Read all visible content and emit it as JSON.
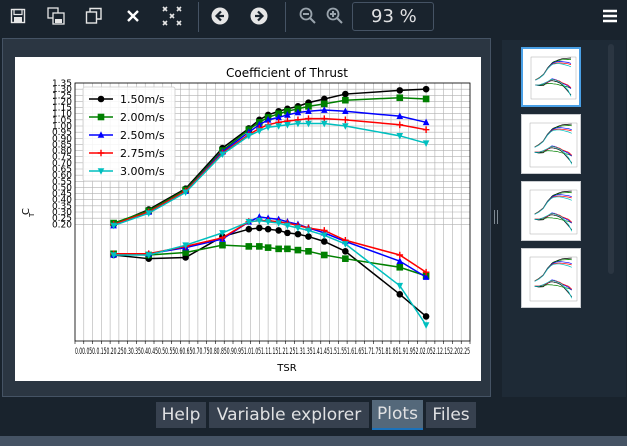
{
  "toolbar": {
    "buttons": [
      "save-icon",
      "save-all-icon",
      "copy-icon",
      "close-icon",
      "close-all-icon",
      "previous-icon",
      "next-icon",
      "zoom-out-icon",
      "zoom-in-icon"
    ],
    "zoom_value": "93 %",
    "menu_icon": "hamburger-menu-icon"
  },
  "tabs": [
    {
      "label": "Help",
      "active": false
    },
    {
      "label": "Variable explorer",
      "active": false
    },
    {
      "label": "Plots",
      "active": true
    },
    {
      "label": "Files",
      "active": false
    }
  ],
  "thumbnails": {
    "count": 4,
    "selected_index": 0
  },
  "colors": {
    "bg": "#19232d",
    "panel": "#2b3642",
    "accent": "#1a72bb"
  },
  "chart_data": {
    "type": "line",
    "title": "Coefficient of Thrust",
    "xlabel": "TSR",
    "ylabel": "C_T",
    "xlim": [
      0,
      2.25
    ],
    "ylim": [
      -0.75,
      1.35
    ],
    "x_ticks": [
      "0.00",
      "0.05",
      "0.10",
      "0.15",
      "0.20",
      "0.25",
      "0.30",
      "0.35",
      "0.40",
      "0.45",
      "0.50",
      "0.55",
      "0.60",
      "0.65",
      "0.70",
      "0.75",
      "0.80",
      "0.85",
      "0.90",
      "0.95",
      "1.00",
      "1.05",
      "1.10",
      "1.15",
      "1.20",
      "1.25",
      "1.30",
      "1.35",
      "1.40",
      "1.45",
      "1.50",
      "1.55",
      "1.60",
      "1.65",
      "1.70",
      "1.75",
      "1.80",
      "1.85",
      "1.90",
      "1.95",
      "2.00",
      "2.05",
      "2.10",
      "2.15",
      "2.20",
      "2.25"
    ],
    "x_tick_display": "0.00.050.0.150.20.250.30.350.40.450.50.550.60.650.70.750.80.850.90.951.01.051.11.151.21.251.31.351.41.451.51.551.61.651.71.751.81.851.91.952.02.052.12.152.202.25",
    "y_ticks": [
      "0.20",
      "0.25",
      "0.30",
      "0.35",
      "0.40",
      "0.45",
      "0.50",
      "0.55",
      "0.60",
      "0.65",
      "0.70",
      "0.75",
      "0.80",
      "0.85",
      "0.90",
      "0.95",
      "1.00",
      "1.05",
      "1.10",
      "1.15",
      "1.20",
      "1.25",
      "1.30",
      "1.35"
    ],
    "grid": true,
    "legend_position": "upper-left",
    "series": [
      {
        "name": "1.50m/s",
        "color": "#000000",
        "marker": "circle",
        "upper_x": [
          0.22,
          0.42,
          0.63,
          0.84,
          0.99,
          1.05,
          1.1,
          1.16,
          1.21,
          1.27,
          1.33,
          1.42,
          1.54,
          1.85,
          2.0
        ],
        "upper_y": [
          0.2,
          0.32,
          0.49,
          0.82,
          0.98,
          1.05,
          1.09,
          1.12,
          1.14,
          1.16,
          1.19,
          1.22,
          1.26,
          1.29,
          1.3
        ],
        "lower_x": [
          0.22,
          0.42,
          0.63,
          0.84,
          0.99,
          1.05,
          1.1,
          1.16,
          1.21,
          1.27,
          1.33,
          1.42,
          1.54,
          1.85,
          2.0
        ],
        "lower_y": [
          -0.05,
          -0.08,
          -0.07,
          0.1,
          0.16,
          0.17,
          0.16,
          0.15,
          0.13,
          0.12,
          0.1,
          0.06,
          -0.02,
          -0.37,
          -0.55
        ]
      },
      {
        "name": "2.00m/s",
        "color": "#008000",
        "marker": "square",
        "upper_x": [
          0.22,
          0.42,
          0.63,
          0.84,
          0.99,
          1.05,
          1.1,
          1.16,
          1.21,
          1.27,
          1.33,
          1.42,
          1.54,
          1.85,
          2.0
        ],
        "upper_y": [
          0.21,
          0.31,
          0.48,
          0.8,
          0.97,
          1.03,
          1.07,
          1.1,
          1.12,
          1.14,
          1.16,
          1.18,
          1.21,
          1.23,
          1.22
        ],
        "lower_x": [
          0.22,
          0.42,
          0.63,
          0.84,
          0.99,
          1.05,
          1.1,
          1.16,
          1.21,
          1.27,
          1.33,
          1.42,
          1.54,
          1.85,
          2.0
        ],
        "lower_y": [
          -0.04,
          -0.05,
          -0.03,
          0.03,
          0.02,
          0.02,
          0.01,
          0.0,
          0.0,
          -0.01,
          -0.02,
          -0.05,
          -0.08,
          -0.15,
          -0.22
        ]
      },
      {
        "name": "2.50m/s",
        "color": "#0000ff",
        "marker": "triangle",
        "upper_x": [
          0.22,
          0.42,
          0.63,
          0.84,
          0.99,
          1.05,
          1.1,
          1.16,
          1.21,
          1.27,
          1.33,
          1.42,
          1.54,
          1.85,
          2.0
        ],
        "upper_y": [
          0.19,
          0.3,
          0.47,
          0.79,
          0.95,
          1.01,
          1.05,
          1.07,
          1.09,
          1.11,
          1.12,
          1.13,
          1.12,
          1.08,
          1.03
        ],
        "lower_x": [
          0.22,
          0.42,
          0.63,
          0.84,
          0.99,
          1.05,
          1.1,
          1.16,
          1.21,
          1.27,
          1.33,
          1.42,
          1.54,
          1.85,
          2.0
        ],
        "lower_y": [
          -0.05,
          -0.04,
          0.01,
          0.08,
          0.22,
          0.26,
          0.25,
          0.24,
          0.22,
          0.2,
          0.17,
          0.13,
          0.06,
          -0.1,
          -0.23
        ]
      },
      {
        "name": "2.75m/s",
        "color": "#ff0000",
        "marker": "plus",
        "upper_x": [
          0.22,
          0.42,
          0.63,
          0.84,
          0.99,
          1.05,
          1.1,
          1.16,
          1.21,
          1.27,
          1.33,
          1.42,
          1.54,
          1.85,
          2.0
        ],
        "upper_y": [
          0.2,
          0.3,
          0.47,
          0.78,
          0.93,
          0.98,
          1.01,
          1.03,
          1.04,
          1.05,
          1.06,
          1.06,
          1.05,
          1.01,
          0.97
        ],
        "lower_x": [
          0.22,
          0.42,
          0.63,
          0.84,
          0.99,
          1.05,
          1.1,
          1.16,
          1.21,
          1.27,
          1.33,
          1.42,
          1.54,
          1.85,
          2.0
        ],
        "lower_y": [
          -0.04,
          -0.04,
          0.02,
          0.09,
          0.22,
          0.23,
          0.23,
          0.22,
          0.21,
          0.19,
          0.17,
          0.15,
          0.07,
          -0.05,
          -0.19
        ]
      },
      {
        "name": "3.00m/s",
        "color": "#00bfbf",
        "marker": "inverted-triangle",
        "upper_x": [
          0.22,
          0.42,
          0.63,
          0.84,
          0.99,
          1.05,
          1.1,
          1.16,
          1.21,
          1.27,
          1.33,
          1.42,
          1.54,
          1.85,
          2.0
        ],
        "upper_y": [
          0.19,
          0.29,
          0.46,
          0.77,
          0.92,
          0.96,
          0.99,
          1.0,
          1.01,
          1.02,
          1.02,
          1.02,
          1.0,
          0.92,
          0.86
        ],
        "lower_x": [
          0.22,
          0.42,
          0.63,
          0.84,
          0.99,
          1.05,
          1.1,
          1.16,
          1.21,
          1.27,
          1.33,
          1.42,
          1.54,
          1.85,
          2.0
        ],
        "lower_y": [
          -0.05,
          -0.05,
          0.03,
          0.13,
          0.22,
          0.23,
          0.22,
          0.21,
          0.19,
          0.17,
          0.15,
          0.11,
          0.04,
          -0.3,
          -0.62
        ]
      }
    ]
  }
}
